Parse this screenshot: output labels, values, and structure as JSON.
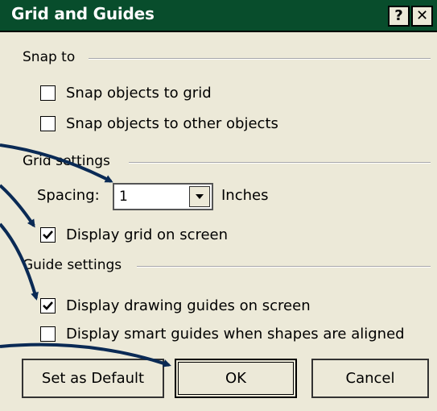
{
  "dialog": {
    "title": "Grid and Guides",
    "help_glyph": "?",
    "close_glyph": "✕"
  },
  "snap_to": {
    "label": "Snap to",
    "options": [
      {
        "label": "Snap objects to grid",
        "checked": false
      },
      {
        "label": "Snap objects to other objects",
        "checked": false
      }
    ]
  },
  "grid_settings": {
    "label": "Grid settings",
    "spacing_label": "Spacing:",
    "spacing_value": "1",
    "spacing_unit": "Inches",
    "display_grid": {
      "label": "Display grid on screen",
      "checked": true
    }
  },
  "guide_settings": {
    "label": "Guide settings",
    "options": [
      {
        "label": "Display drawing guides on screen",
        "checked": true
      },
      {
        "label": "Display smart guides when shapes are aligned",
        "checked": false
      }
    ]
  },
  "buttons": {
    "set_default": "Set as Default",
    "ok": "OK",
    "cancel": "Cancel"
  },
  "colors": {
    "titlebar": "#084d2c",
    "dialog_bg": "#ece9d8",
    "annotation_arrow": "#0a2a55"
  }
}
